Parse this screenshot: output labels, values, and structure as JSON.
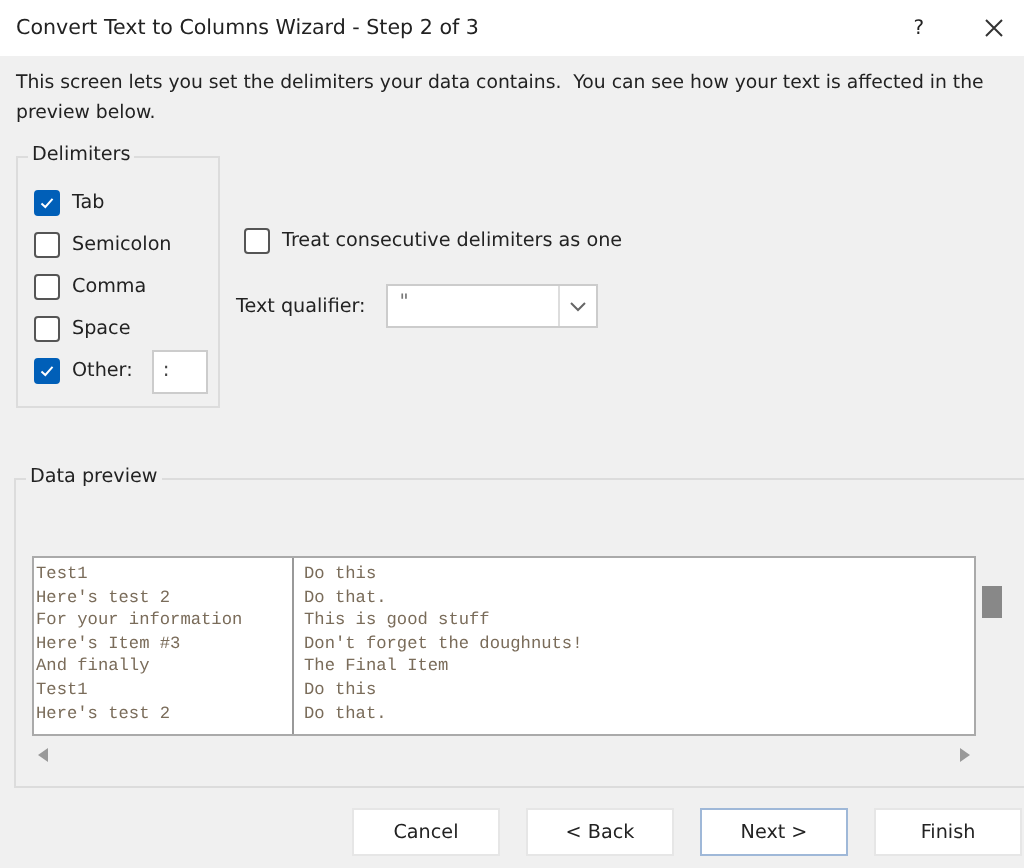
{
  "window": {
    "title": "Convert Text to Columns Wizard - Step 2 of 3",
    "help": "?"
  },
  "description": "This screen lets you set the delimiters your data contains.  You can see how your text is affected in the preview below.",
  "delimiters": {
    "title": "Delimiters",
    "options": [
      {
        "kind": "checkbox",
        "label": "Tab",
        "checked": true
      },
      {
        "kind": "checkbox",
        "label": "Semicolon",
        "checked": false
      },
      {
        "kind": "checkbox",
        "label": "Comma",
        "checked": false
      },
      {
        "kind": "checkbox",
        "label": "Space",
        "checked": false
      },
      {
        "kind": "checkbox_field",
        "label": "Other:",
        "checked": true,
        "value": ":"
      }
    ]
  },
  "consecutive": {
    "label": "Treat consecutive delimiters as one",
    "checked": false
  },
  "text_qualifier": {
    "label": "Text qualifier:",
    "value": "\""
  },
  "data_preview": {
    "title": "Data preview",
    "rows": [
      {
        "column_1": "Test1",
        "column_2": "Do this"
      },
      {
        "column_1": "Here's test 2",
        "column_2": "Do that."
      },
      {
        "column_1": "For your information",
        "column_2": "This is good stuff"
      },
      {
        "column_1": "Here's Item #3",
        "column_2": "Don't forget the doughnuts!"
      },
      {
        "column_1": "And finally",
        "column_2": "The Final Item"
      },
      {
        "column_1": "Test1",
        "column_2": "Do this"
      },
      {
        "column_1": "Here's test 2",
        "column_2": "Do that."
      }
    ]
  },
  "buttons": [
    {
      "label": "Cancel",
      "default": false
    },
    {
      "label": "< Back",
      "default": false
    },
    {
      "label": "Next >",
      "default": true
    },
    {
      "label": "Finish",
      "default": false
    }
  ]
}
